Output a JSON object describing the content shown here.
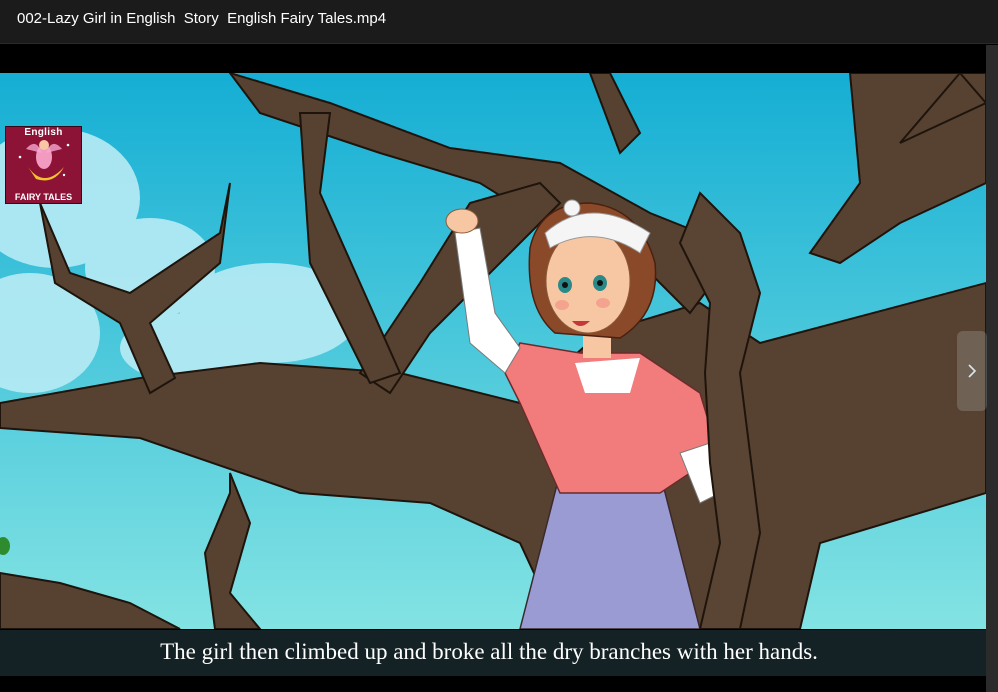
{
  "window": {
    "title": "002-Lazy Girl in English  Story  English Fairy Tales.mp4"
  },
  "logo": {
    "top_text": "English",
    "bottom_text": "FAIRY TALES"
  },
  "player": {
    "subtitle": "The girl then climbed up and broke all the dry branches with her hands.",
    "next_icon": "chevron-right-icon"
  },
  "colors": {
    "sky_top": "#18b2d6",
    "sky_bottom": "#7fe0e4",
    "branch": "#5a4433",
    "dress": "#f27b7b",
    "apron": "#9b9bd4",
    "hair": "#8a4a2a"
  }
}
